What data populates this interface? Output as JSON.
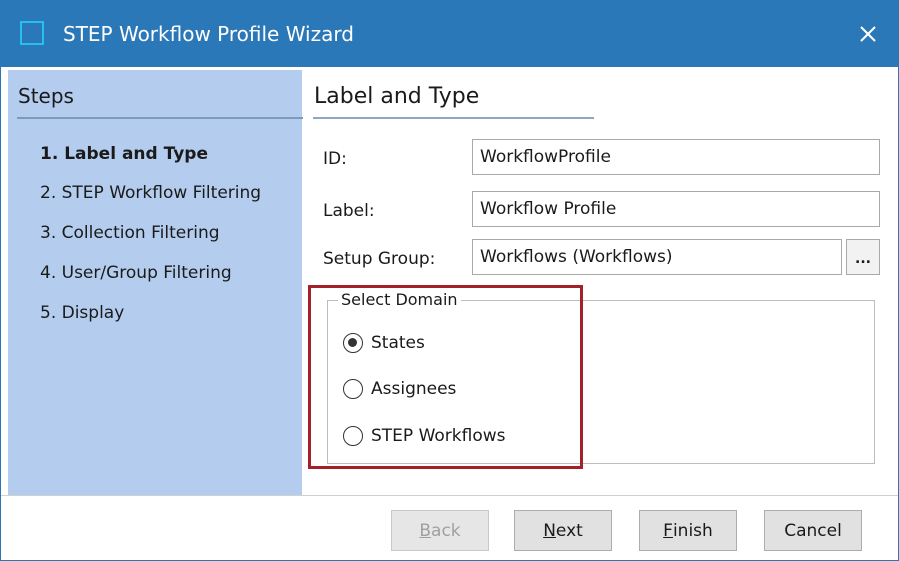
{
  "window": {
    "title": "STEP Workflow Profile Wizard",
    "close_glyph": "✕"
  },
  "steps": {
    "title": "Steps",
    "items": [
      {
        "label": "1. Label and Type",
        "active": true
      },
      {
        "label": "2. STEP Workflow Filtering",
        "active": false
      },
      {
        "label": "3. Collection Filtering",
        "active": false
      },
      {
        "label": "4. User/Group Filtering",
        "active": false
      },
      {
        "label": "5. Display",
        "active": false
      }
    ]
  },
  "main": {
    "section_title": "Label and Type",
    "fields": {
      "id": {
        "label": "ID:",
        "value": "WorkflowProfile"
      },
      "label": {
        "label": "Label:",
        "value": "Workflow Profile"
      },
      "setup_group": {
        "label": "Setup Group:",
        "value": "Workflows (Workflows)",
        "browse_label": "..."
      }
    },
    "domain": {
      "legend": "Select Domain",
      "options": [
        {
          "label": "States",
          "checked": true
        },
        {
          "label": "Assignees",
          "checked": false
        },
        {
          "label": "STEP Workflows",
          "checked": false
        }
      ]
    }
  },
  "buttons": {
    "back": {
      "mnemonic": "B",
      "rest": "ack",
      "disabled": true
    },
    "next": {
      "mnemonic": "N",
      "rest": "ext"
    },
    "finish": {
      "mnemonic": "F",
      "rest": "inish"
    },
    "cancel": {
      "label": "Cancel"
    }
  },
  "colors": {
    "titlebar": "#2b78b9",
    "steps_panel": "#b4cdee",
    "highlight": "#a3222a"
  },
  "icons": {
    "app": "app-icon",
    "close": "close-icon",
    "browse": "browse-icon"
  }
}
